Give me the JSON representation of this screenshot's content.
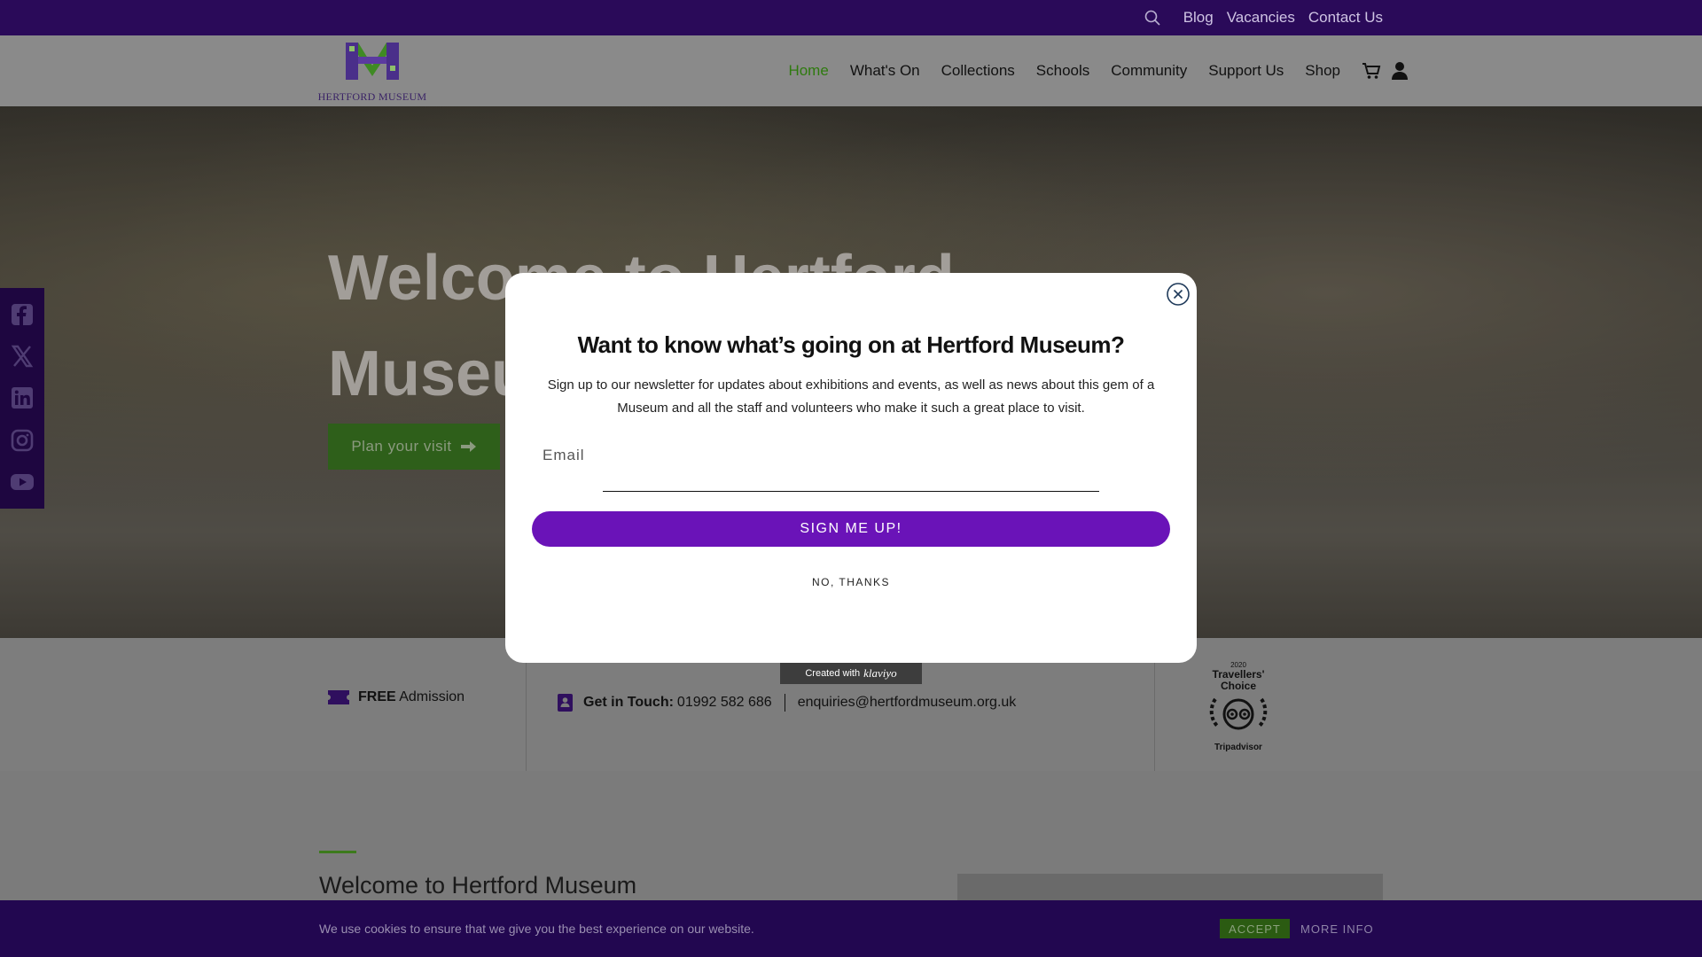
{
  "topbar": {
    "links": [
      "Blog",
      "Vacancies",
      "Contact Us"
    ]
  },
  "logo": {
    "text": "HERTFORD MUSEUM"
  },
  "nav": {
    "items": [
      "Home",
      "What's On",
      "Collections",
      "Schools",
      "Community",
      "Support Us",
      "Shop"
    ],
    "active": "Home"
  },
  "hero": {
    "title": "Welcome to Hertford Museum",
    "cta": "Plan your visit"
  },
  "info": {
    "free_bold": "FREE",
    "free_text": "Admission",
    "contact_label": "Get in Touch:",
    "phone": "01992 582 686",
    "email": "enquiries@hertfordmuseum.org.uk",
    "trip_year": "2020",
    "trip_award": "Travellers' Choice",
    "trip_brand": "Tripadvisor"
  },
  "lower": {
    "heading": "Welcome to Hertford Museum"
  },
  "cookie": {
    "message": "We use cookies to ensure that we give you the best experience on our website.",
    "accept": "ACCEPT",
    "more": "MORE INFO"
  },
  "modal": {
    "title": "Want to know what’s going on at Hertford Museum?",
    "body": "Sign up to our newsletter for updates about exhibitions and events, as well as news about this gem of a Museum and all the staff and volunteers who make it such a great place to visit.",
    "email_placeholder": "Email",
    "submit": "SIGN ME UP!",
    "decline": "NO, THANKS",
    "badge_prefix": "Created with",
    "badge_brand": "klaviyo"
  },
  "colors": {
    "topbar": "#2a0a59",
    "accent_green": "#2e7a0e",
    "signup_purple": "#6a13b8"
  }
}
